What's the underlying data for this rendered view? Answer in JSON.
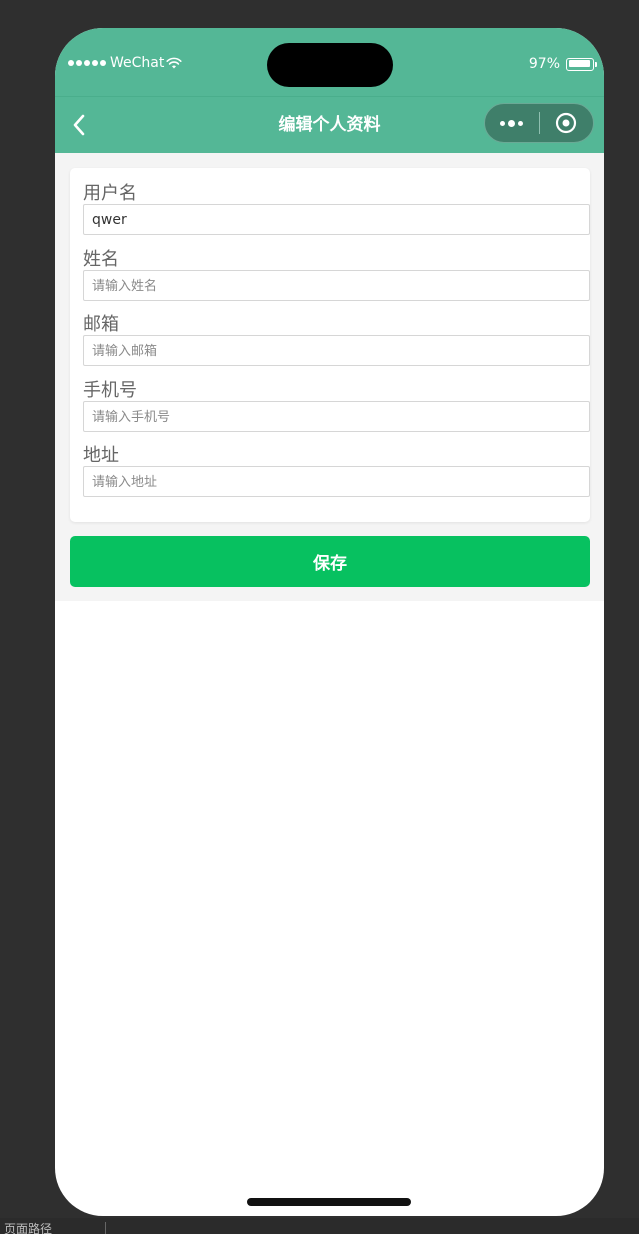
{
  "status_bar": {
    "carrier": "WeChat",
    "battery_text": "97%",
    "battery_level": 0.97,
    "signal_bars": 5
  },
  "nav": {
    "title": "编辑个人资料",
    "back_icon": "chevron-left-icon",
    "more_icon": "more-dots-icon",
    "close_icon": "target-circle-icon"
  },
  "form": {
    "fields": [
      {
        "label": "用户名",
        "value": "qwer",
        "placeholder": ""
      },
      {
        "label": "姓名",
        "value": "",
        "placeholder": "请输入姓名"
      },
      {
        "label": "邮箱",
        "value": "",
        "placeholder": "请输入邮箱"
      },
      {
        "label": "手机号",
        "value": "",
        "placeholder": "请输入手机号"
      },
      {
        "label": "地址",
        "value": "",
        "placeholder": "请输入地址"
      }
    ],
    "save_label": "保存"
  },
  "bottom_bar": {
    "path_label": "页面路径"
  },
  "colors": {
    "nav_bg": "#54b796",
    "primary_button": "#07c160",
    "page_bg": "#f4f4f4",
    "outer_bg": "#2f2f2f"
  }
}
